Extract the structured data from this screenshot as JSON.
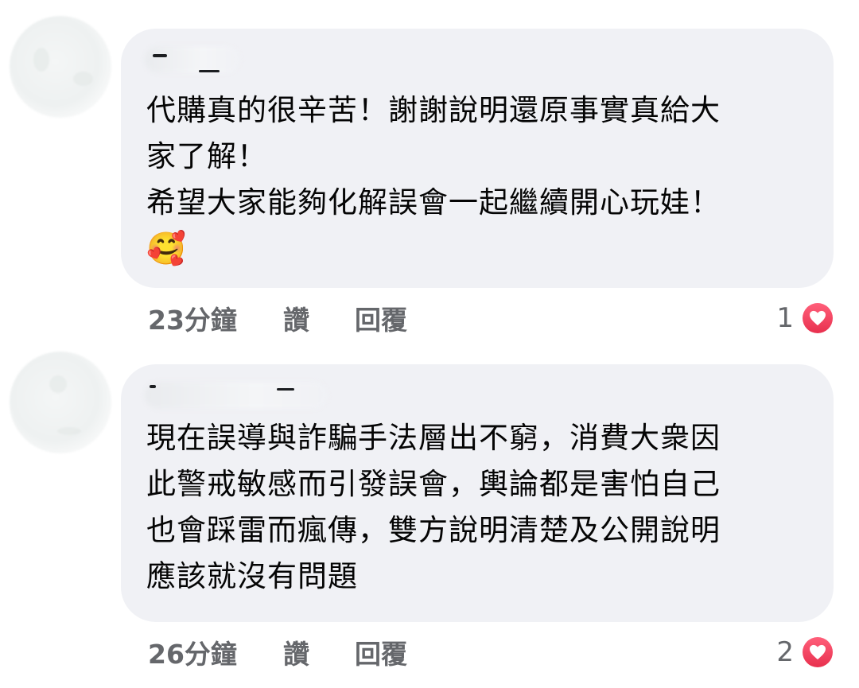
{
  "comments": [
    {
      "lines": [
        "代購真的很辛苦！謝謝說明還原事實真給大",
        "家了解！",
        "希望大家能夠化解誤會一起繼續開心玩娃！"
      ],
      "emoji": "🥰",
      "time": "23分鐘",
      "like_label": "讚",
      "reply_label": "回覆",
      "reaction_count": "1",
      "reaction_icon": "heart-icon"
    },
    {
      "lines": [
        "現在誤導與詐騙手法層出不窮，消費大衆因",
        "此警戒敏感而引發誤會，輿論都是害怕自己",
        "也會踩雷而瘋傳，雙方說明清楚及公開說明",
        "應該就沒有問題"
      ],
      "time": "26分鐘",
      "like_label": "讚",
      "reply_label": "回覆",
      "reaction_count": "2",
      "reaction_icon": "heart-icon"
    }
  ],
  "colors": {
    "bubble": "#f0f1f5",
    "meta_text": "#65676b",
    "heart": "#e8304e"
  }
}
